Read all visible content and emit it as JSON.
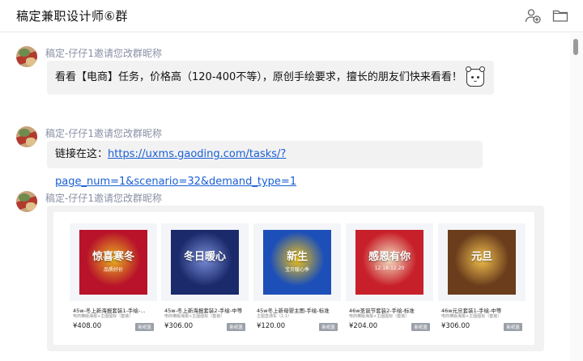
{
  "window": {
    "title": "稿定兼职设计师⑥群",
    "icons": [
      "add-member-icon",
      "folder-icon"
    ]
  },
  "messages": [
    {
      "sender": "稿定-仔仔1邀请您改群昵称",
      "text": "看看【电商】任务，价格高（120-400不等），原创手绘要求，擅长的朋友们快来看看！",
      "emoji": "bear-face-emoji"
    },
    {
      "sender": "稿定-仔仔1邀请您改群昵称",
      "prefix": "链接在这：",
      "link": "https://uxms.gaoding.com/tasks/?page_num=1&scenario=32&demand_type=1"
    },
    {
      "sender": "稿定-仔仔1邀请您改群昵称",
      "cards": [
        {
          "name": "45w-冬上新海报套装1-手绘-…",
          "sub": "电商横版海报+主图图标（套装）",
          "price": "¥408.00",
          "tag": "新纸篮",
          "colors": [
            "#b8132a",
            "#e9b321"
          ]
        },
        {
          "name": "45w-冬上新海报套装2-手绘-中等",
          "sub": "电商横版海报+主图图标（套装）",
          "price": "¥306.00",
          "tag": "新纸篮",
          "colors": [
            "#1b2a6b",
            "#7a8fd8"
          ]
        },
        {
          "name": "45w冬上新母婴主图-手绘-标准",
          "sub": "主图直通车（1:1）",
          "price": "¥120.00",
          "tag": "新纸篮",
          "colors": [
            "#1d4fb8",
            "#f0c419"
          ]
        },
        {
          "name": "46w圣诞节套装2-手绘-标准",
          "sub": "电商横版海报+主图图标（套装）",
          "price": "¥204.00",
          "tag": "新纸篮",
          "colors": [
            "#c8202a",
            "#f3e3c4"
          ]
        },
        {
          "name": "46w元旦套装1-手绘-中等",
          "sub": "电商横版海报+主图图标（套装）",
          "price": "¥306.00",
          "tag": "新纸篮",
          "colors": [
            "#6b3d1c",
            "#f2c14e"
          ]
        }
      ],
      "card_posters": [
        {
          "title": "惊喜寒冬",
          "subtitle": "品质好价"
        },
        {
          "title": "冬日暖心",
          "subtitle": ""
        },
        {
          "title": "新生",
          "subtitle": "宝贝暖心季"
        },
        {
          "title": "感恩有你",
          "subtitle": "12.18-12.20"
        },
        {
          "title": "元旦",
          "subtitle": ""
        }
      ]
    }
  ]
}
